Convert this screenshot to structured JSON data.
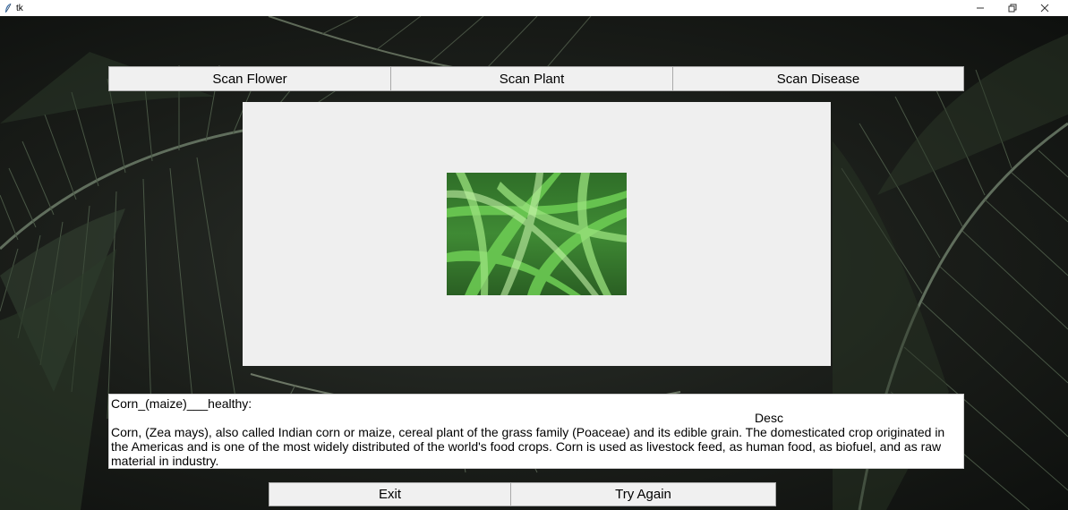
{
  "window": {
    "title": "tk",
    "icon": "feather-icon",
    "controls": [
      "minimize-icon",
      "restore-icon",
      "close-icon"
    ]
  },
  "toolbar": {
    "scan_flower_label": "Scan Flower",
    "scan_plant_label": "Scan Plant",
    "scan_disease_label": "Scan Disease"
  },
  "result": {
    "label": "Corn_(maize)___healthy:",
    "desc_heading": "Desc",
    "description": "Corn, (Zea mays), also called Indian corn or maize, cereal plant of the grass family (Poaceae) and its edible grain. The domesticated crop originated in the Americas and is one of the most widely distributed of the world's food crops. Corn is used as livestock feed, as human food, as biofuel, and as raw material in industry."
  },
  "actions": {
    "exit_label": "Exit",
    "try_again_label": "Try Again"
  },
  "colors": {
    "button_bg": "#f0f0f0",
    "panel_bg": "#efefef",
    "background_dark": "#1a1d19",
    "leaf_green": "#3f5a3a",
    "plant_green": "#4caf3f"
  }
}
